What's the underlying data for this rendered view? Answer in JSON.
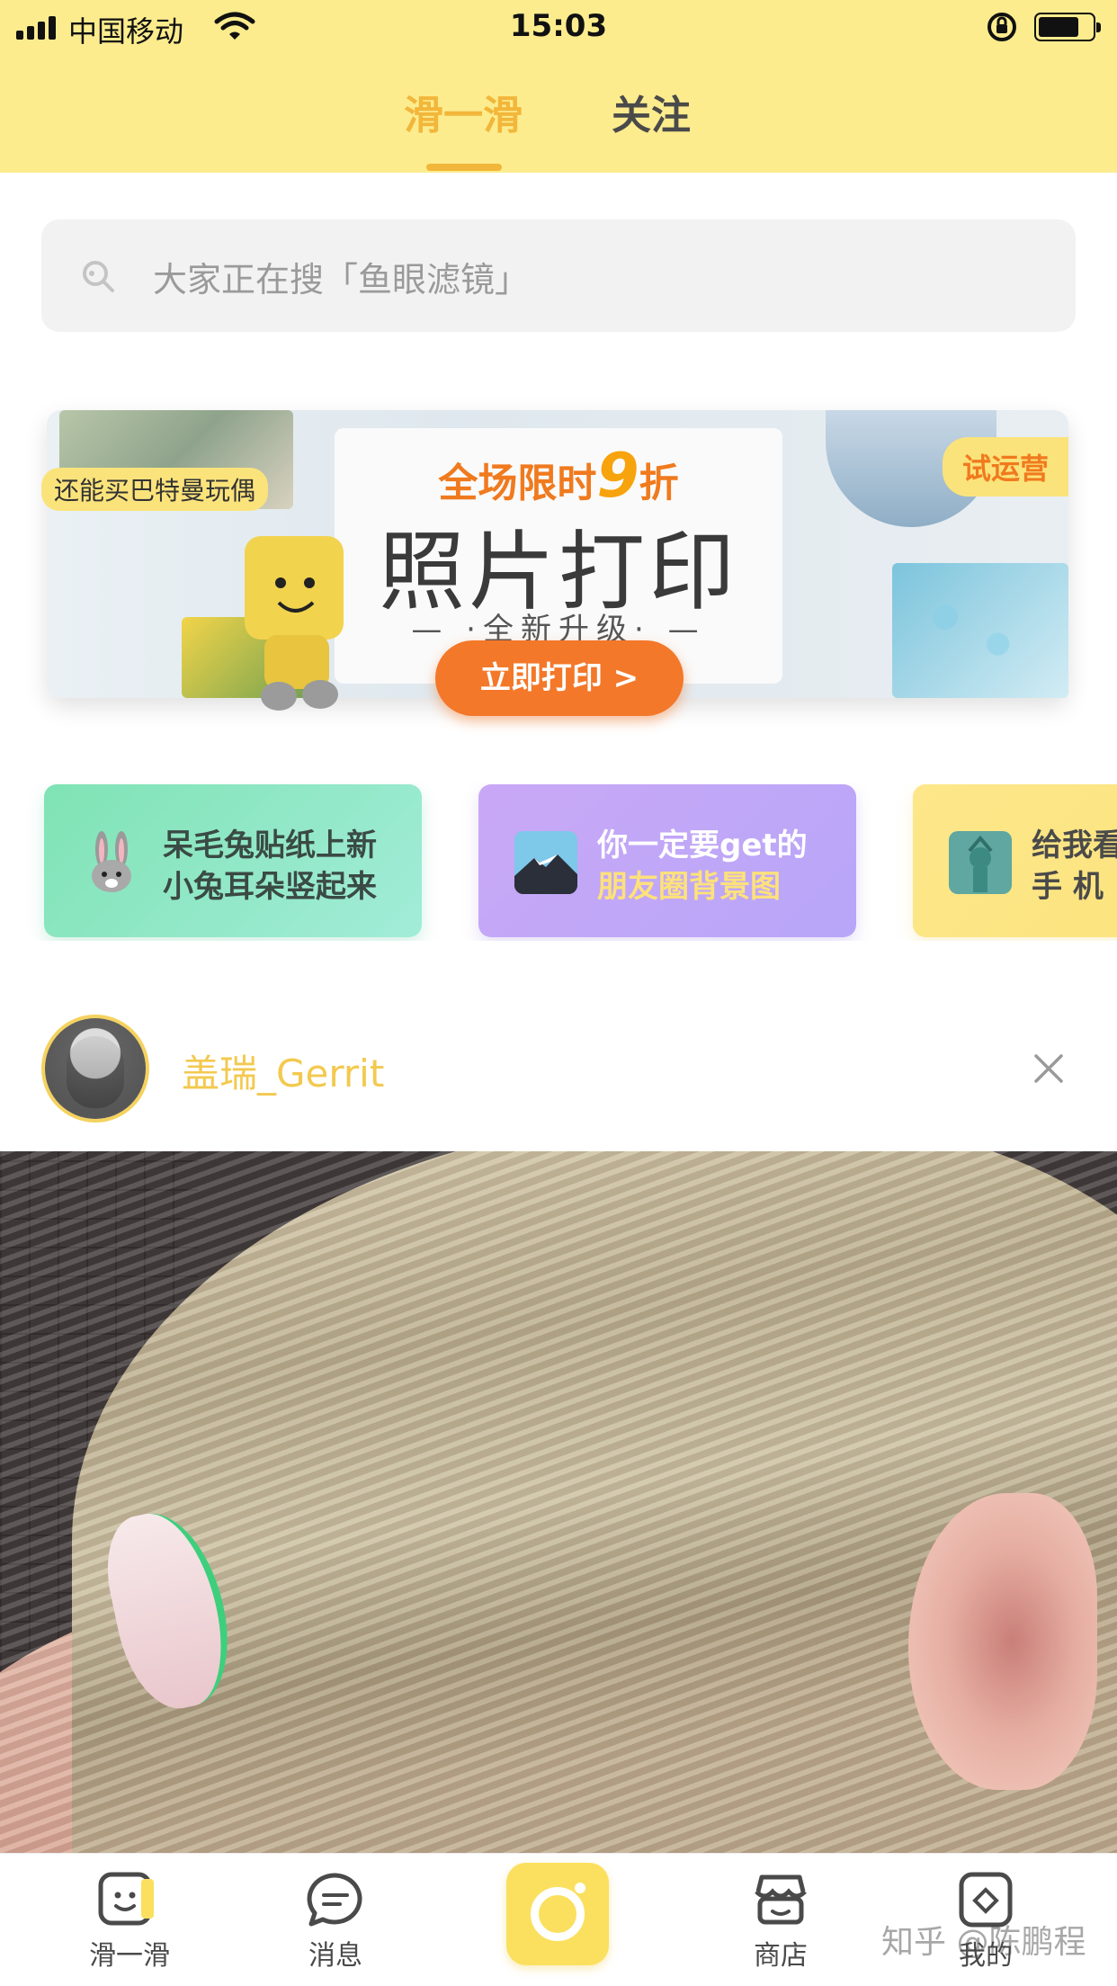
{
  "status_bar": {
    "carrier": "中国移动",
    "time": "15:03"
  },
  "header": {
    "tabs": [
      {
        "label": "滑一滑",
        "active": true
      },
      {
        "label": "关注",
        "active": false
      }
    ],
    "active_color": "#f2b63a",
    "background": "#fcec8e"
  },
  "search": {
    "placeholder": "大家正在搜「鱼眼滤镜」"
  },
  "banner": {
    "promo_prefix": "全场限时",
    "promo_number": "9",
    "promo_suffix": "折",
    "title": "照片打印",
    "subtitle": "— ·全新升级· —",
    "button": "立即打印 >",
    "tag_left": "还能买巴特曼玩偶",
    "tag_right": "试运营"
  },
  "topic_cards": [
    {
      "line1": "呆毛兔贴纸上新",
      "line2": "小兔耳朵竖起来",
      "icon": "rabbit-icon"
    },
    {
      "line1": "你一定要get的",
      "line2": "朋友圈背景图",
      "icon": "mountain-icon"
    },
    {
      "line1": "给我看",
      "line2": "手 机",
      "icon": "statue-of-liberty-icon"
    }
  ],
  "post": {
    "username": "盖瑞_Gerrit"
  },
  "bottom_nav": {
    "items": [
      {
        "label": "滑一滑",
        "icon": "swipe-face-icon"
      },
      {
        "label": "消息",
        "icon": "message-icon"
      },
      {
        "label": "",
        "icon": "camera-icon"
      },
      {
        "label": "商店",
        "icon": "shop-icon"
      },
      {
        "label": "我的",
        "icon": "profile-icon"
      }
    ]
  },
  "watermark": "知乎 @陈鹏程"
}
